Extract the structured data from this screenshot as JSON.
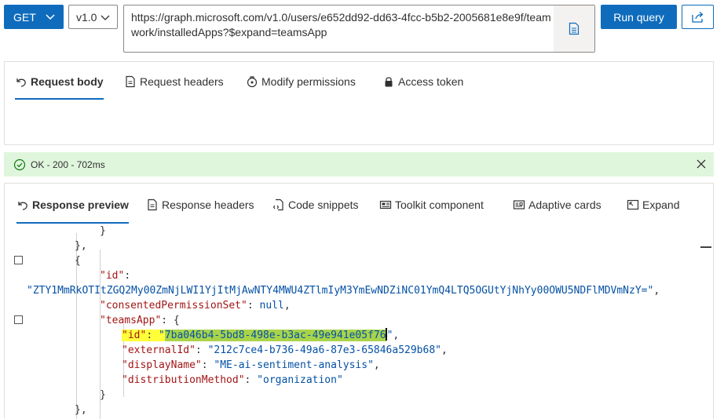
{
  "toolbar": {
    "method": "GET",
    "version": "v1.0",
    "url": "https://graph.microsoft.com/v1.0/users/e652dd92-dd63-4fcc-b5b2-2005681e8e9f/teamwork/installedApps?$expand=teamsApp",
    "run_label": "Run query",
    "accent_color": "#0f6cbd"
  },
  "request_tabs": [
    {
      "label": "Request body",
      "icon": "undo-arrow-icon",
      "active": true
    },
    {
      "label": "Request headers",
      "icon": "document-icon",
      "active": false
    },
    {
      "label": "Modify permissions",
      "icon": "shield-icon",
      "active": false
    },
    {
      "label": "Access token",
      "icon": "lock-icon",
      "active": false
    }
  ],
  "status": {
    "text": "OK - 200 - 702ms",
    "color": "#dff6dd"
  },
  "response_tabs": [
    {
      "label": "Response preview",
      "icon": "undo-arrow-icon",
      "active": true
    },
    {
      "label": "Response headers",
      "icon": "document-icon",
      "active": false
    },
    {
      "label": "Code snippets",
      "icon": "code-file-icon",
      "active": false
    },
    {
      "label": "Toolkit component",
      "icon": "toolkit-icon",
      "active": false
    },
    {
      "label": "Adaptive cards",
      "icon": "card-icon",
      "active": false
    },
    {
      "label": "Expand",
      "icon": "expand-icon",
      "active": false
    }
  ],
  "response": {
    "close_brace_1": "},",
    "open_brace": "{",
    "id_key": "\"id\"",
    "id_value": "\"ZTY1MmRkOTItZGQ2My00ZmNjLWI1YjItMjAwNTY4MWU4ZTlmIyM3YmEwNDZiNC01YmQ4LTQ5OGUtYjNhYy00OWU5NDFlMDVmNzY=\"",
    "consented_key": "\"consentedPermissionSet\"",
    "consented_value": "null",
    "teamsapp_key": "\"teamsApp\"",
    "app_id_key": "\"id\"",
    "app_id_value_open": "\"",
    "app_id_value_body": "7ba046b4-5bd8-498e-b3ac-49e941e05f76",
    "app_id_value_close": "\"",
    "external_key": "\"externalId\"",
    "external_value": "\"212c7ce4-b736-49a6-87e3-65846a529b68\"",
    "display_key": "\"displayName\"",
    "display_value": "\"ME-ai-sentiment-analysis\"",
    "distribution_key": "\"distributionMethod\"",
    "distribution_value": "\"organization\"",
    "close_inner": "}",
    "close_brace_2": "},"
  }
}
